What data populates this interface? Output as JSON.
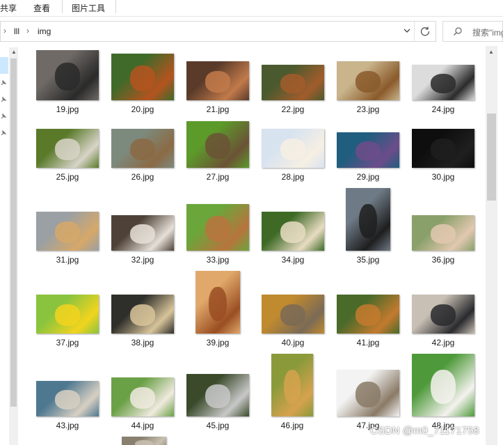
{
  "ribbon": {
    "tabs": [
      "共享",
      "查看",
      "图片工具"
    ]
  },
  "address": {
    "root_crumb": "lll",
    "folder": "img"
  },
  "search": {
    "placeholder": "搜索\"img\""
  },
  "files": [
    {
      "name": "19.jpg",
      "colors": [
        "#6f6a66",
        "#2a2a2a"
      ]
    },
    {
      "name": "20.jpg",
      "colors": [
        "#3f6a2a",
        "#b5531f"
      ]
    },
    {
      "name": "21.jpg",
      "colors": [
        "#5a3b2a",
        "#c27a4a"
      ]
    },
    {
      "name": "22.jpg",
      "colors": [
        "#4b5a2e",
        "#a25c2c"
      ]
    },
    {
      "name": "23.jpg",
      "colors": [
        "#c9b48c",
        "#8a5a2a"
      ]
    },
    {
      "name": "24.jpg",
      "colors": [
        "#dcdcdc",
        "#2b2b2b"
      ]
    },
    {
      "name": "25.jpg",
      "colors": [
        "#5a7a2a",
        "#d8d4c8"
      ]
    },
    {
      "name": "26.jpg",
      "colors": [
        "#7c8a7e",
        "#8b6a44"
      ]
    },
    {
      "name": "27.jpg",
      "colors": [
        "#5c9a2a",
        "#6b5236"
      ]
    },
    {
      "name": "28.jpg",
      "colors": [
        "#d8e3f0",
        "#f6efe3"
      ]
    },
    {
      "name": "29.jpg",
      "colors": [
        "#1f5e7e",
        "#6d4c8a"
      ]
    },
    {
      "name": "30.jpg",
      "colors": [
        "#0e0e0e",
        "#1f1f1f"
      ]
    },
    {
      "name": "31.jpg",
      "colors": [
        "#9aa0a4",
        "#d6a868"
      ]
    },
    {
      "name": "32.jpg",
      "colors": [
        "#4e4238",
        "#e6e0d8"
      ]
    },
    {
      "name": "33.jpg",
      "colors": [
        "#6aa63a",
        "#b8743e"
      ]
    },
    {
      "name": "34.jpg",
      "colors": [
        "#3e6a26",
        "#e8dcc2"
      ]
    },
    {
      "name": "35.jpg",
      "colors": [
        "#6e7a86",
        "#1e1e1e"
      ]
    },
    {
      "name": "36.jpg",
      "colors": [
        "#8aa06a",
        "#e2c8b0"
      ]
    },
    {
      "name": "37.jpg",
      "colors": [
        "#8ac43e",
        "#f2d41e"
      ]
    },
    {
      "name": "38.jpg",
      "colors": [
        "#2e2e2a",
        "#d8c49a"
      ]
    },
    {
      "name": "39.jpg",
      "colors": [
        "#e0a86a",
        "#9a4e22"
      ]
    },
    {
      "name": "40.jpg",
      "colors": [
        "#c08a2e",
        "#7a6a56"
      ]
    },
    {
      "name": "41.jpg",
      "colors": [
        "#4a6a2a",
        "#c47a2e"
      ]
    },
    {
      "name": "42.jpg",
      "colors": [
        "#c8c0b4",
        "#2a2a2e"
      ]
    },
    {
      "name": "43.jpg",
      "colors": [
        "#4e7890",
        "#d8d0c2"
      ]
    },
    {
      "name": "44.jpg",
      "colors": [
        "#6aa046",
        "#f0eadf"
      ]
    },
    {
      "name": "45.jpg",
      "colors": [
        "#3a4a2a",
        "#c8c8c8"
      ]
    },
    {
      "name": "46.jpg",
      "colors": [
        "#8a9a3a",
        "#d6a24e"
      ]
    },
    {
      "name": "47.jpg",
      "colors": [
        "#f3f3f3",
        "#8a7a66"
      ]
    },
    {
      "name": "48.jpg",
      "colors": [
        "#4e9a3a",
        "#f4f2ee"
      ]
    },
    {
      "name": "",
      "colors": [
        "#8a8070",
        "#c8c0b0"
      ]
    }
  ],
  "watermark": "CSDN @m0_71171758"
}
